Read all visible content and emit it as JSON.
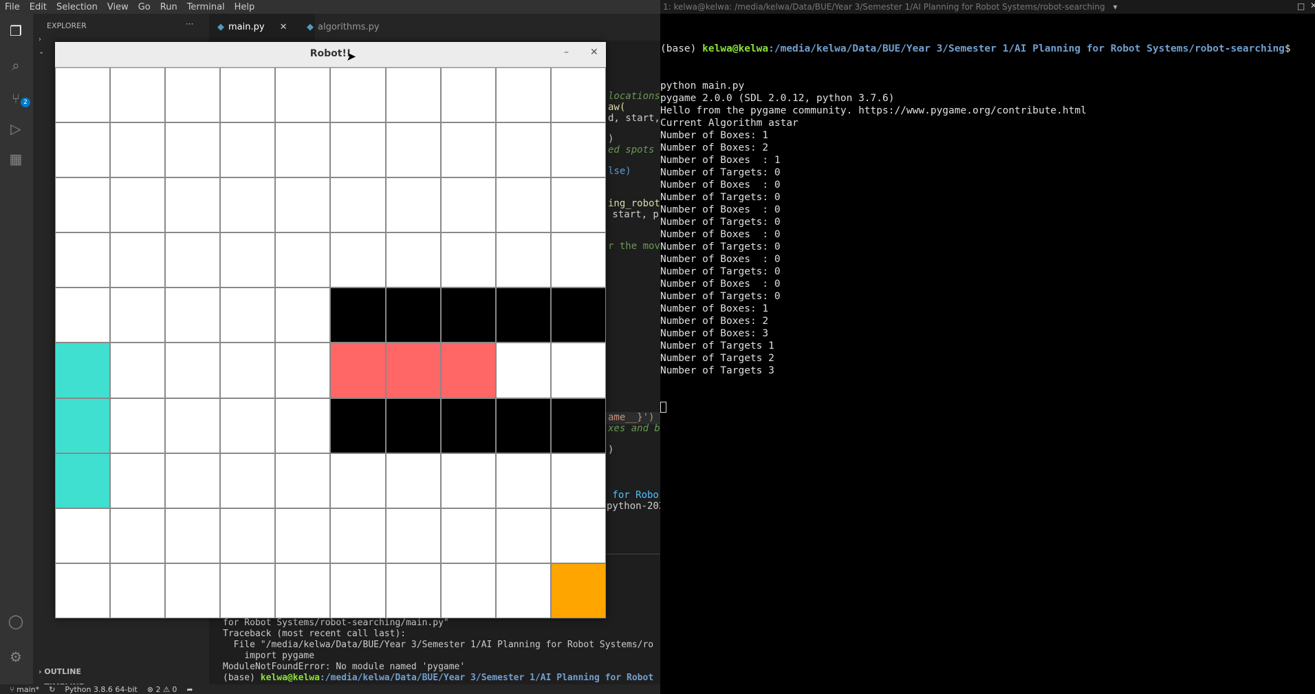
{
  "menu": [
    "File",
    "Edit",
    "Selection",
    "View",
    "Go",
    "Run",
    "Terminal",
    "Help"
  ],
  "sidebar": {
    "title": "EXPLORER",
    "more": "···",
    "outline": "OUTLINE",
    "timeline": "TIMELINE"
  },
  "activity": {
    "scm_badge": "2"
  },
  "tabs": [
    {
      "label": "main.py",
      "active": true
    },
    {
      "label": "algorithms.py",
      "active": false
    }
  ],
  "editor_fragments": [
    {
      "text": "locations",
      "color": "#6a9955",
      "italic": true
    },
    {
      "text": "aw(",
      "color": "#dcdcaa"
    },
    {
      "text": "d, start,",
      "color": "#cccccc"
    },
    {
      "text": ")",
      "color": "#cccccc"
    },
    {
      "text": "ed spots",
      "color": "#6a9955",
      "italic": true
    },
    {
      "text": "lse)",
      "color": "#569cd6"
    },
    {
      "text": "ing_robot(",
      "color": "#dcdcaa"
    },
    {
      "text": " start, p",
      "color": "#cccccc"
    },
    {
      "text": "r the move",
      "color": "#6a9955"
    },
    {
      "text": "ame__}')",
      "color": "#ce9178"
    },
    {
      "text": "xes and ba",
      "color": "#6a9955",
      "italic": true
    },
    {
      "text": ")",
      "color": "#cccccc"
    },
    {
      "text": " for Robo",
      "color": "#4fc1ff"
    },
    {
      "text": "python-202",
      "color": "#cccccc"
    }
  ],
  "panel": {
    "line1": "for Robot Systems/robot-searching/main.py\"",
    "line2": "Traceback (most recent call last):",
    "line3": "  File \"/media/kelwa/Data/BUE/Year 3/Semester 1/AI Planning for Robot Systems/ro",
    "line4": "    import pygame",
    "line5": "ModuleNotFoundError: No module named 'pygame'",
    "prompt_base": "(base) ",
    "prompt_user": "kelwa@kelwa",
    "prompt_path": ":/media/kelwa/Data/BUE/Year 3/Semester 1/AI Planning for Robot"
  },
  "statusbar": {
    "branch": "main*",
    "python": "Python 3.8.6 64-bit",
    "errors": "2",
    "warnings": "0"
  },
  "terminal": {
    "title": "1: kelwa@kelwa: /media/kelwa/Data/BUE/Year 3/Semester 1/AI Planning for Robot Systems/robot-searching",
    "prompt_base": "(base) ",
    "prompt_user": "kelwa@kelwa",
    "prompt_path": ":/media/kelwa/Data/BUE/Year 3/Semester 1/AI Planning for Robot Systems/robot-searching",
    "prompt_end": "$",
    "lines": [
      "python main.py",
      "pygame 2.0.0 (SDL 2.0.12, python 3.7.6)",
      "Hello from the pygame community. https://www.pygame.org/contribute.html",
      "Current Algorithm astar",
      "Number of Boxes: 1",
      "Number of Boxes: 2",
      "Number of Boxes  : 1",
      "Number of Targets: 0",
      "Number of Boxes  : 0",
      "Number of Targets: 0",
      "Number of Boxes  : 0",
      "Number of Targets: 0",
      "Number of Boxes  : 0",
      "Number of Targets: 0",
      "Number of Boxes  : 0",
      "Number of Targets: 0",
      "Number of Boxes  : 0",
      "Number of Targets: 0",
      "Number of Boxes: 1",
      "Number of Boxes: 2",
      "Number of Boxes: 3",
      "Number of Targets 1",
      "Number of Targets 2",
      "Number of Targets 3"
    ]
  },
  "robot_window": {
    "title": "Robot!!",
    "colors": {
      "empty": "#ffffff",
      "wall": "#000000",
      "target": "#ff6666",
      "box": "#40e0d0",
      "robot": "#ffa500"
    },
    "grid": [
      "..........",
      "..........",
      "..........",
      "..........",
      ".....WWWWW",
      "B....TTT..",
      "B....WWWWW",
      "B.........",
      "..........",
      ".........R."
    ]
  }
}
